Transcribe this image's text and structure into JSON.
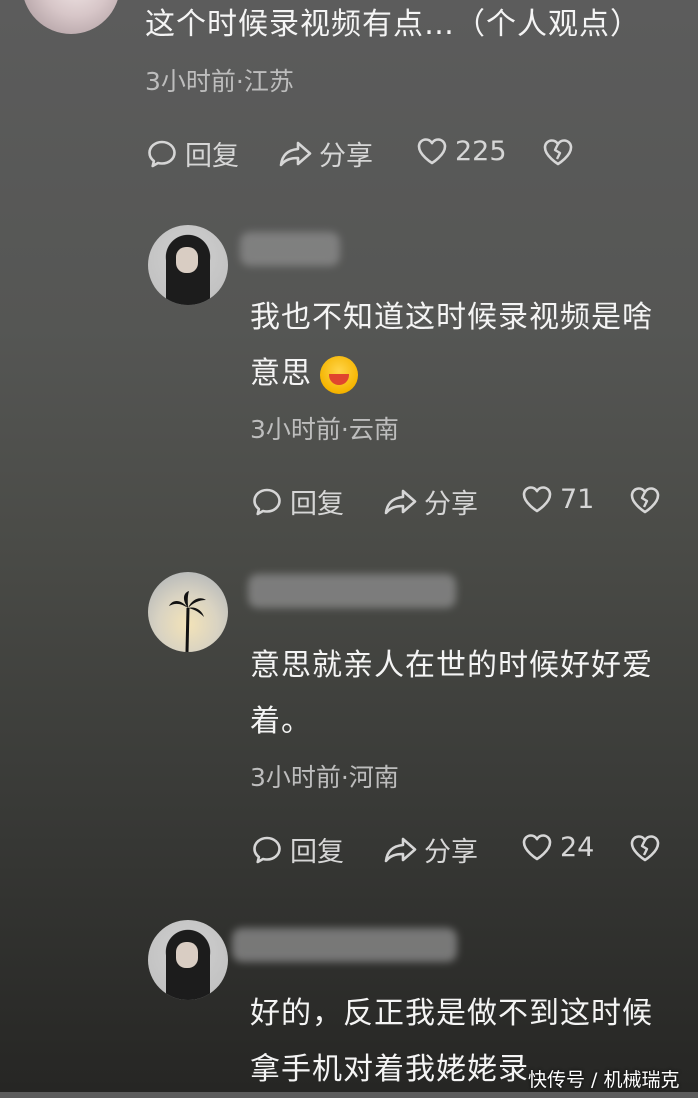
{
  "comments": [
    {
      "text": "这个时候录视频有点…（个人观点）",
      "meta": "3小时前·江苏",
      "reply": "回复",
      "share": "分享",
      "likes": "225"
    },
    {
      "text_line1": "我也不知道这时候录视频是啥",
      "text_line2": "意思",
      "meta": "3小时前·云南",
      "reply": "回复",
      "share": "分享",
      "likes": "71"
    },
    {
      "text_line1": "意思就亲人在世的时候好好爱",
      "text_line2": "着。",
      "meta": "3小时前·河南",
      "reply": "回复",
      "share": "分享",
      "likes": "24"
    },
    {
      "text_line1": "好的，反正我是做不到这时候",
      "text_line2": "拿手机对着我姥姥录"
    }
  ],
  "watermark": "快传号 / 机械瑞克",
  "icons": {
    "reply": "comment-bubble-icon",
    "share": "share-arrow-icon",
    "like": "heart-outline-icon",
    "dislike": "broken-heart-icon",
    "emoji": "grinning-face-emoji"
  },
  "colors": {
    "text": "#f4f4f4",
    "meta": "#bdbdbd",
    "action": "#d6d6d6"
  }
}
